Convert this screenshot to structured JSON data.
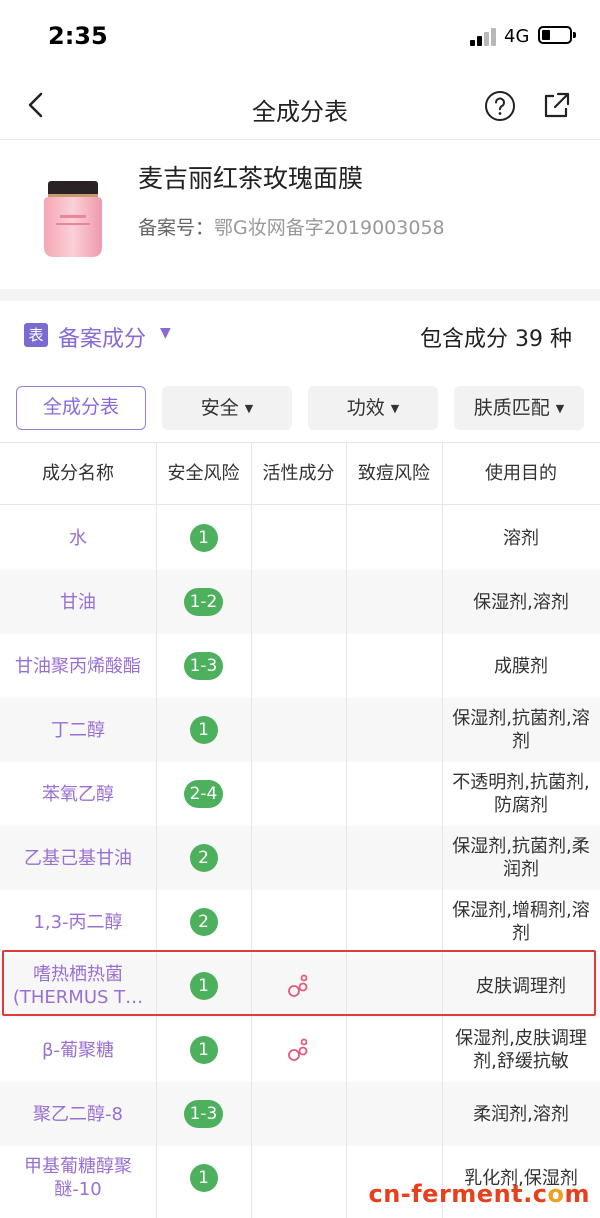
{
  "status": {
    "time": "2:35",
    "network": "4G"
  },
  "nav": {
    "title": "全成分表"
  },
  "product": {
    "name": "麦吉丽红茶玫瑰面膜",
    "record_label": "备案号：",
    "record_value": "鄂G妆网备字2019003058"
  },
  "summary": {
    "tag": "表",
    "record_dropdown": "备案成分",
    "count_text": "包含成分 39 种"
  },
  "filters": [
    {
      "label": "全成分表"
    },
    {
      "label": "安全"
    },
    {
      "label": "功效"
    },
    {
      "label": "肤质匹配"
    }
  ],
  "table": {
    "headers": [
      "成分名称",
      "安全风险",
      "活性成分",
      "致痘风险",
      "使用目的"
    ],
    "rows": [
      {
        "name": "水",
        "safety": "1",
        "active": false,
        "purpose": "溶剂"
      },
      {
        "name": "甘油",
        "safety": "1-2",
        "active": false,
        "purpose": "保湿剂,溶剂"
      },
      {
        "name": "甘油聚丙烯酸酯",
        "safety": "1-3",
        "active": false,
        "purpose": "成膜剂"
      },
      {
        "name": "丁二醇",
        "safety": "1",
        "active": false,
        "purpose": "保湿剂,抗菌剂,溶剂"
      },
      {
        "name": "苯氧乙醇",
        "safety": "2-4",
        "active": false,
        "purpose": "不透明剂,抗菌剂,防腐剂"
      },
      {
        "name": "乙基己基甘油",
        "safety": "2",
        "active": false,
        "purpose": "保湿剂,抗菌剂,柔润剂"
      },
      {
        "name": "1,3-丙二醇",
        "safety": "2",
        "active": false,
        "purpose": "保湿剂,增稠剂,溶剂"
      },
      {
        "name": "嗜热栖热菌(THERMUS T…",
        "safety": "1",
        "active": true,
        "purpose": "皮肤调理剂"
      },
      {
        "name": "β-葡聚糖",
        "safety": "1",
        "active": true,
        "purpose": "保湿剂,皮肤调理剂,舒缓抗敏"
      },
      {
        "name": "聚乙二醇-8",
        "safety": "1-3",
        "active": false,
        "purpose": "柔润剂,溶剂"
      },
      {
        "name": "甲基葡糖醇聚醚-10",
        "safety": "1",
        "active": false,
        "purpose": "乳化剂,保湿剂"
      }
    ]
  },
  "watermark": {
    "text_a": "cn-ferment.c",
    "text_o": "o",
    "text_b": "m"
  },
  "colors": {
    "accent": "#8a6ad6",
    "badge_green": "#4db05d",
    "highlight_red": "#e03a3a"
  }
}
